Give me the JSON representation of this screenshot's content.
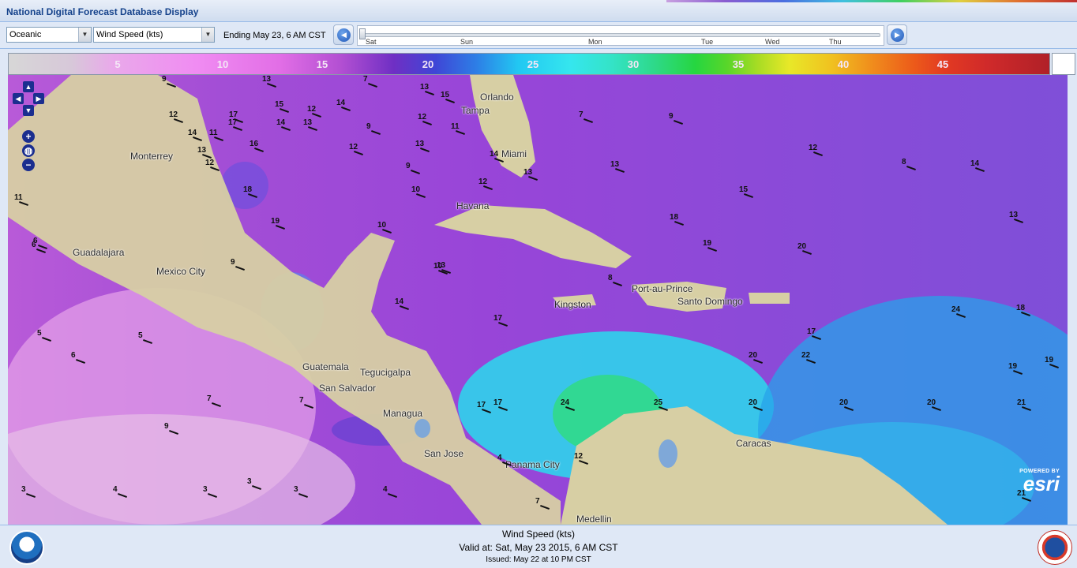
{
  "app": {
    "title": "National Digital Forecast Database Display"
  },
  "toolbar": {
    "sector_select": "Oceanic",
    "element_select": "Wind Speed (kts)",
    "ending_label": "Ending May 23,   6 AM CST",
    "timeline_days": [
      "Sat",
      "Sun",
      "Mon",
      "Tue",
      "Wed",
      "Thu"
    ]
  },
  "legend": {
    "ticks": [
      "5",
      "10",
      "15",
      "20",
      "25",
      "30",
      "35",
      "40",
      "45"
    ]
  },
  "map": {
    "cities": [
      "Monterrey",
      "Guadalajara",
      "Mexico City",
      "Havana",
      "Miami",
      "Tampa",
      "Orlando",
      "Kingston",
      "Port-au-Prince",
      "Santo Domingo",
      "Guatemala",
      "Tegucigalpa",
      "San Salvador",
      "Managua",
      "San Jose",
      "Panama City",
      "Medellin",
      "Caracas"
    ],
    "wind_labels": [
      "11",
      "6",
      "9",
      "12",
      "13",
      "15",
      "14",
      "13",
      "12",
      "16",
      "17",
      "18",
      "19",
      "9",
      "12",
      "11",
      "14",
      "13",
      "17",
      "14",
      "12",
      "10",
      "7",
      "9",
      "9",
      "10",
      "13",
      "13",
      "11",
      "10",
      "12",
      "13",
      "14",
      "15",
      "12",
      "14",
      "13",
      "18",
      "19",
      "20",
      "24",
      "22",
      "17",
      "17",
      "17",
      "17",
      "24",
      "25",
      "20",
      "20",
      "20",
      "21",
      "20",
      "18",
      "19",
      "19",
      "21",
      "4",
      "12",
      "7",
      "3",
      "4",
      "3",
      "3",
      "3",
      "4",
      "9",
      "6",
      "5",
      "5",
      "6",
      "7",
      "7",
      "8",
      "12",
      "15",
      "14",
      "13",
      "8",
      "9",
      "13",
      "7"
    ],
    "esri_powered": "POWERED BY",
    "esri_brand": "esri"
  },
  "footer": {
    "element": "Wind Speed (kts)",
    "valid_at": "Valid at:  Sat, May 23 2015,    6 AM CST",
    "issued": "Issued: May 22 at 10 PM CST"
  },
  "colors": {
    "chrome": "#dfe8f6",
    "title_text": "#15428b",
    "border": "#99bbe8"
  }
}
